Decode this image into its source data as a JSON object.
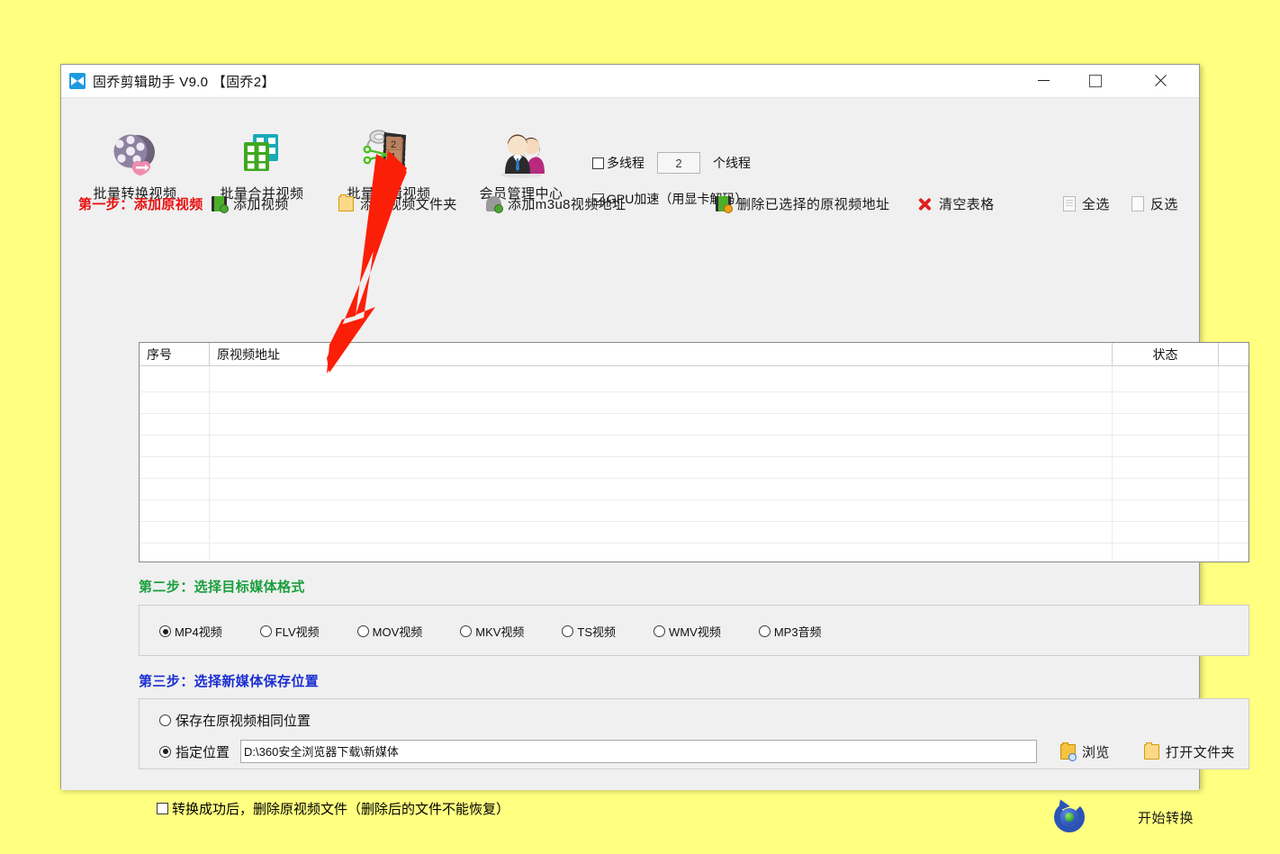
{
  "window": {
    "title": "固乔剪辑助手 V9.0 【固乔2】",
    "app_icon": "video-app-icon",
    "controls": {
      "minimize": "minimize-icon",
      "maximize": "maximize-icon",
      "close": "close-icon"
    }
  },
  "toolbar": {
    "items": [
      {
        "label": "批量转换视频",
        "icon": "film-reel-convert-icon"
      },
      {
        "label": "批量合并视频",
        "icon": "film-strips-merge-icon"
      },
      {
        "label": "批量剪辑视频",
        "icon": "film-scissors-trim-icon"
      },
      {
        "label": "会员管理中心",
        "icon": "members-icon"
      }
    ],
    "multithread": {
      "checkbox_label": "多线程",
      "checked": false,
      "count": "2",
      "unit_label": "个线程"
    },
    "gpu": {
      "checkbox_label": "GPU加速（用显卡解码）",
      "checked": true
    }
  },
  "step1": {
    "title": "第一步：添加原视频",
    "actions": [
      {
        "label": "添加视频",
        "icon": "film-add-icon"
      },
      {
        "label": "添加视频文件夹",
        "icon": "folder-add-icon"
      },
      {
        "label": "添加m3u8视频地址",
        "icon": "m3u8-add-icon"
      },
      {
        "label": "删除已选择的原视频地址",
        "icon": "film-delete-icon"
      },
      {
        "label": "清空表格",
        "icon": "red-x-icon"
      },
      {
        "label": "全选",
        "icon": "select-all-icon"
      },
      {
        "label": "反选",
        "icon": "invert-selection-icon"
      }
    ]
  },
  "table": {
    "columns": [
      "序号",
      "原视频地址",
      "状态"
    ],
    "rows": []
  },
  "step2": {
    "title": "第二步：选择目标媒体格式",
    "selected": "MP4视频",
    "options": [
      {
        "label": "MP4视频",
        "checked": true
      },
      {
        "label": "FLV视频",
        "checked": false
      },
      {
        "label": "MOV视频",
        "checked": false
      },
      {
        "label": "MKV视频",
        "checked": false
      },
      {
        "label": "TS视频",
        "checked": false
      },
      {
        "label": "WMV视频",
        "checked": false
      },
      {
        "label": "MP3音频",
        "checked": false
      }
    ]
  },
  "step3": {
    "title": "第三步：选择新媒体保存位置",
    "same_location": {
      "label": "保存在原视频相同位置",
      "checked": false
    },
    "custom_location": {
      "label": "指定位置",
      "checked": true
    },
    "path_value": "D:\\360安全浏览器下载\\新媒体",
    "browse_button": {
      "label": "浏览",
      "icon": "folder-search-icon"
    },
    "open_folder_button": {
      "label": "打开文件夹",
      "icon": "folder-open-icon"
    }
  },
  "bottom": {
    "delete_after_label": "转换成功后，删除原视频文件（删除后的文件不能恢复）",
    "delete_after_checked": false,
    "start_button": {
      "label": "开始转换",
      "icon": "refresh-start-icon"
    }
  },
  "annotation": {
    "arrow": "red-arrow-pointing-to-trim-video",
    "color": "#fb1f08"
  },
  "colors": {
    "background": "#ffff80",
    "step1_title": "#e81010",
    "step2_title": "#1a9e3d",
    "step3_title": "#1b2fd0",
    "window_bg": "#f0f0f0"
  }
}
